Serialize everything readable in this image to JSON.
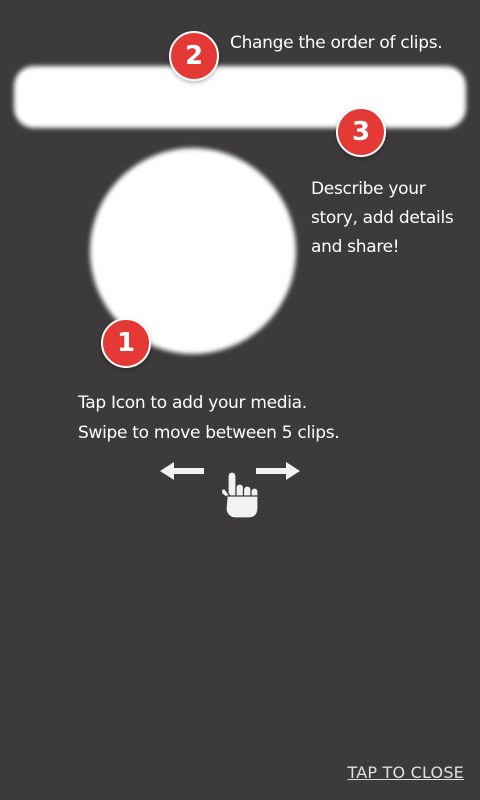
{
  "colors": {
    "overlay_background": "#3d3a3b",
    "step_badge": "#e53935",
    "spotlight": "#ffffff",
    "text": "#ffffff"
  },
  "steps": [
    {
      "number": "1",
      "lines": [
        "Tap Icon to add your media.",
        "Swipe to move between 5 clips."
      ]
    },
    {
      "number": "2",
      "lines": [
        "Change the order of clips."
      ]
    },
    {
      "number": "3",
      "lines": [
        "Describe your",
        "story, add details",
        "and share!"
      ]
    }
  ],
  "gesture": {
    "icons": [
      "arrow-left-icon",
      "hand-pointer-icon",
      "arrow-right-icon"
    ]
  },
  "close": {
    "label": "TAP TO CLOSE"
  }
}
